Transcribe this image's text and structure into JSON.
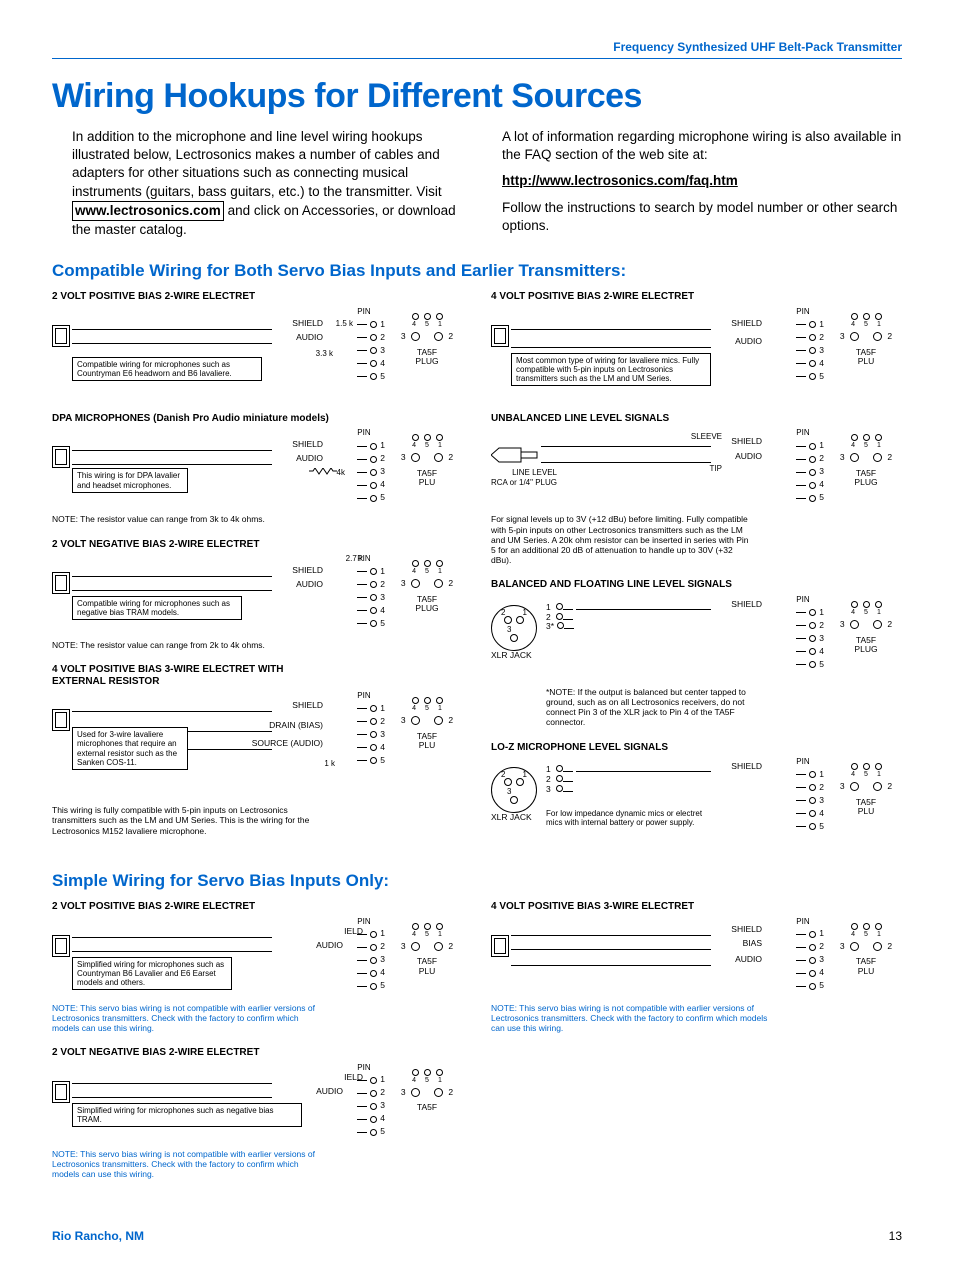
{
  "header": "Frequency Synthesized UHF Belt-Pack Transmitter",
  "title": "Wiring Hookups for Different Sources",
  "intro_left": "In addition to the microphone and line level wiring hook­ups illustrated below, Lectrosonics makes a number of cables and adapters for other situations such as con­necting musical instruments (guitars, bass guitars, etc.) to the transmitter. Visit ",
  "intro_link1": "www.lectrosonics.com",
  "intro_left2": " and click on Accessories, or download the master catalog.",
  "intro_right1": "A lot of information regarding microphone wiring is also available in the FAQ section of the web site at:",
  "intro_link2": "http://www.lectrosonics.com/faq.htm",
  "intro_right2": "Follow the instructions to search by model number or other search options.",
  "section1": "Compatible Wiring for Both Servo Bias Inputs and Earlier Transmitters:",
  "section2": "Simple Wiring for Servo Bias Inputs Only:",
  "pin_label": "PIN",
  "ta5f_label": "TA5F\nPLUG",
  "ta5f_label_short": "TA5F\nPLU",
  "pins": [
    "1",
    "2",
    "3",
    "4",
    "5"
  ],
  "ta5f_top": [
    "4",
    "5",
    "1"
  ],
  "ta5f_bot": [
    "3",
    "2"
  ],
  "shield": "SHIELD",
  "audio": "AUDIO",
  "ield": "IELD",
  "bias": "BIAS",
  "drain": "DRAIN (BIAS)",
  "source": "SOURCE (AUDIO)",
  "sleeve": "SLEEVE",
  "tip": "TIP",
  "line_level_rca": "LINE LEVEL\nRCA or 1/4\" PLUG",
  "xlr_jack": "XLR JACK",
  "d1": {
    "title": "2 VOLT POSITIVE BIAS 2-WIRE ELECTRET",
    "r1": "1.5 k",
    "r2": "3.3 k",
    "caption": "Compatible wiring for microphones such as Countryman E6 headworn and B6 lavaliere."
  },
  "d2": {
    "title": "DPA MICROPHONES (Danish Pro Audio miniature models)",
    "r1": "4k",
    "caption": "This wiring is for DPA lavalier and headset microphones.",
    "note": "NOTE: The resistor value can range from 3k to 4k ohms."
  },
  "d3": {
    "title": "2 VOLT NEGATIVE BIAS 2-WIRE ELECTRET",
    "r1": "2.7 k",
    "caption": "Compatible wiring for microphones such as negative bias TRAM models.",
    "note": "NOTE: The resistor value can range from 2k to 4k ohms."
  },
  "d4": {
    "title": "4 VOLT POSITIVE BIAS 3-WIRE ELECTRET WITH EXTERNAL RESISTOR",
    "r1": "1 k",
    "caption": "Used for 3-wire lavaliere microphones that require an external resistor such as the Sanken COS-11.",
    "note": "This wiring is fully compatible with 5-pin inputs on Lectrosonics transmitters such as the LM and UM Series. This is the wiring for the Lectrosonics M152 lavaliere microphone."
  },
  "d5": {
    "title": "4 VOLT POSITIVE BIAS 2-WIRE ELECTRET",
    "caption": "Most common type of wiring for lavaliere mics. Fully compatible with 5-pin inputs on Lectrosonics transmitters such as the LM and UM Series."
  },
  "d6": {
    "title": "UNBALANCED LINE LEVEL SIGNALS",
    "caption": "For signal levels up to 3V (+12 dBu) before limiting. Fully compatible with 5-pin inputs on other Lectrosonics transmitters such as the LM and UM Series. A 20k ohm resistor can be inserted in series with Pin 5 for an additional 20 dB of attenuation to handle up to 30V (+32 dBu)."
  },
  "d7": {
    "title": "BALANCED AND FLOATING LINE LEVEL SIGNALS",
    "caption": "*NOTE: If the output is balanced but center tapped to ground, such as on all Lectrosonics receivers, do not connect Pin 3 of the XLR jack to Pin 4 of the TA5F connector."
  },
  "d8": {
    "title": "LO-Z MICROPHONE LEVEL SIGNALS",
    "caption": "For low impedance dynamic mics or electret mics with internal battery or power supply."
  },
  "simple1": {
    "title": "2 VOLT POSITIVE BIAS 2-WIRE ELECTRET",
    "caption": "Simplified wiring for microphones such as Countryman B6 Lavalier and E6 Earset models and others.",
    "note": "NOTE: This servo bias wiring is not compatible with earlier versions of Lectrosonics transmitters. Check with the factory to confirm which models can use this wiring."
  },
  "simple2": {
    "title": "2 VOLT NEGATIVE BIAS 2-WIRE ELECTRET",
    "caption": "Simplified wiring for microphones such as negative bias TRAM.",
    "note": "NOTE: This servo bias wiring is not compatible with earlier versions of Lectrosonics transmitters. Check with the factory to confirm which models can use this wiring."
  },
  "simple3": {
    "title": "4 VOLT POSITIVE BIAS 3-WIRE ELECTRET",
    "note": "NOTE: This servo bias wiring is not compatible with earlier versions of Lectrosonics transmitters. Check with the factory to confirm which models can use this wiring."
  },
  "footer_left": "Rio Rancho, NM",
  "footer_right": "13"
}
